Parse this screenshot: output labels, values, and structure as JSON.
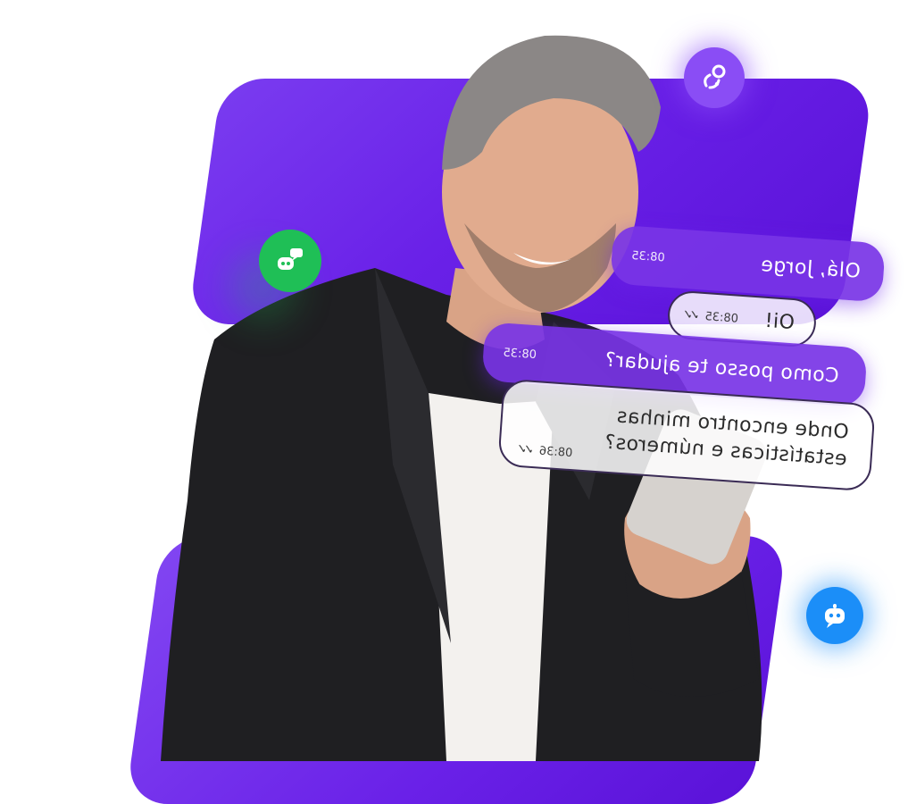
{
  "chat": [
    {
      "text": "Olá, Jorge",
      "time": "08:35",
      "style": "filled"
    },
    {
      "text": "Oi!",
      "time": "08:35",
      "status": "read-check-icon",
      "style": "outline"
    },
    {
      "text": "Como posso te ajudar?",
      "time": "08:35",
      "style": "filled"
    },
    {
      "text_line1": "Onde encontro minhas",
      "text_line2": "estatísticas e números?",
      "time": "08:36",
      "status": "read-check-icon",
      "style": "outline"
    }
  ],
  "badges": [
    {
      "icon": "link-chain-icon",
      "color": "#8a4df5"
    },
    {
      "icon": "robot-chat-icon",
      "color": "#1fbf56"
    },
    {
      "icon": "robot-face-icon",
      "color": "#1b8ef8"
    }
  ],
  "colors": {
    "primary_purple": "#6a21e8",
    "green": "#1fbf56",
    "blue": "#1b8ef8"
  }
}
